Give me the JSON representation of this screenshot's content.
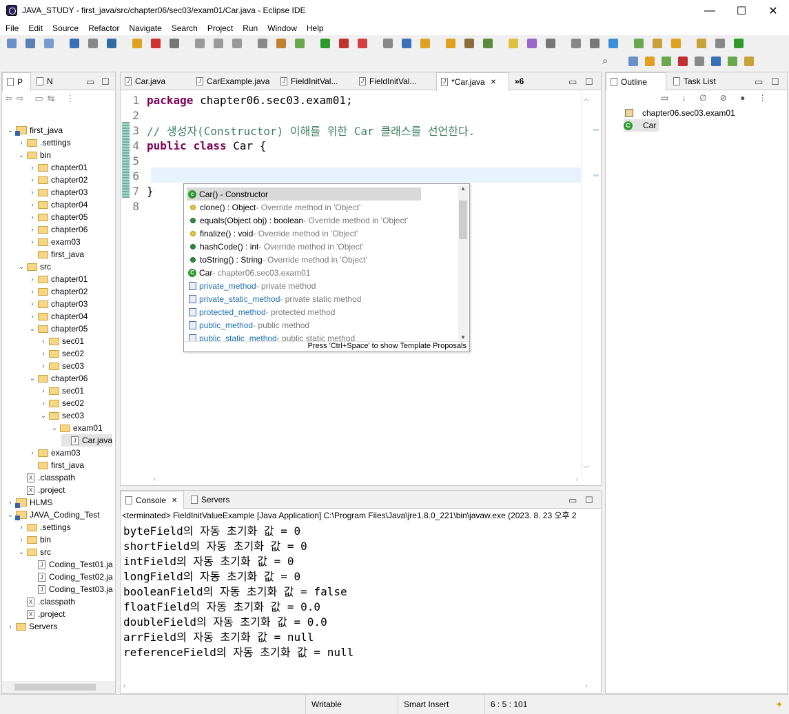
{
  "window": {
    "title": "JAVA_STUDY - first_java/src/chapter06/sec03/exam01/Car.java - Eclipse IDE",
    "minimize": "—",
    "maximize": "☐",
    "close": "✕"
  },
  "menu": [
    "File",
    "Edit",
    "Source",
    "Refactor",
    "Navigate",
    "Search",
    "Project",
    "Run",
    "Window",
    "Help"
  ],
  "explorer": {
    "tabs": [
      "P",
      "N"
    ],
    "tree": [
      {
        "label": "first_java",
        "arrow": "open",
        "type": "project",
        "level": 0
      },
      {
        "label": ".settings",
        "arrow": "closed",
        "type": "folder",
        "level": 1
      },
      {
        "label": "bin",
        "arrow": "open",
        "type": "folder",
        "level": 1
      },
      {
        "label": "chapter01",
        "arrow": "closed",
        "type": "folder",
        "level": 2
      },
      {
        "label": "chapter02",
        "arrow": "closed",
        "type": "folder",
        "level": 2
      },
      {
        "label": "chapter03",
        "arrow": "closed",
        "type": "folder",
        "level": 2
      },
      {
        "label": "chapter04",
        "arrow": "closed",
        "type": "folder",
        "level": 2
      },
      {
        "label": "chapter05",
        "arrow": "closed",
        "type": "folder",
        "level": 2
      },
      {
        "label": "chapter06",
        "arrow": "closed",
        "type": "folder",
        "level": 2
      },
      {
        "label": "exam03",
        "arrow": "closed",
        "type": "folder",
        "level": 2
      },
      {
        "label": "first_java",
        "arrow": "none",
        "type": "folder",
        "level": 2
      },
      {
        "label": "src",
        "arrow": "open",
        "type": "folder",
        "level": 1
      },
      {
        "label": "chapter01",
        "arrow": "closed",
        "type": "folder",
        "level": 2
      },
      {
        "label": "chapter02",
        "arrow": "closed",
        "type": "folder",
        "level": 2
      },
      {
        "label": "chapter03",
        "arrow": "closed",
        "type": "folder",
        "level": 2
      },
      {
        "label": "chapter04",
        "arrow": "closed",
        "type": "folder",
        "level": 2
      },
      {
        "label": "chapter05",
        "arrow": "open",
        "type": "folder",
        "level": 2
      },
      {
        "label": "sec01",
        "arrow": "closed",
        "type": "folder",
        "level": 3
      },
      {
        "label": "sec02",
        "arrow": "closed",
        "type": "folder",
        "level": 3
      },
      {
        "label": "sec03",
        "arrow": "closed",
        "type": "folder",
        "level": 3
      },
      {
        "label": "chapter06",
        "arrow": "open",
        "type": "folder",
        "level": 2
      },
      {
        "label": "sec01",
        "arrow": "closed",
        "type": "folder",
        "level": 3
      },
      {
        "label": "sec02",
        "arrow": "closed",
        "type": "folder",
        "level": 3
      },
      {
        "label": "sec03",
        "arrow": "open",
        "type": "folder",
        "level": 3
      },
      {
        "label": "exam01",
        "arrow": "open",
        "type": "folder",
        "level": 4
      },
      {
        "label": "Car.java",
        "arrow": "none",
        "type": "java",
        "level": 5,
        "selected": true
      },
      {
        "label": "exam03",
        "arrow": "closed",
        "type": "folder",
        "level": 2
      },
      {
        "label": "first_java",
        "arrow": "none",
        "type": "folder",
        "level": 2
      },
      {
        "label": ".classpath",
        "arrow": "none",
        "type": "xfile",
        "level": 1
      },
      {
        "label": ".project",
        "arrow": "none",
        "type": "xfile",
        "level": 1
      },
      {
        "label": "HLMS",
        "arrow": "closed",
        "type": "project",
        "level": 0
      },
      {
        "label": "JAVA_Coding_Test",
        "arrow": "open",
        "type": "project",
        "level": 0
      },
      {
        "label": ".settings",
        "arrow": "closed",
        "type": "folder",
        "level": 1
      },
      {
        "label": "bin",
        "arrow": "closed",
        "type": "folder",
        "level": 1
      },
      {
        "label": "src",
        "arrow": "open",
        "type": "folder",
        "level": 1
      },
      {
        "label": "Coding_Test01.ja",
        "arrow": "none",
        "type": "java",
        "level": 2
      },
      {
        "label": "Coding_Test02.ja",
        "arrow": "none",
        "type": "java",
        "level": 2
      },
      {
        "label": "Coding_Test03.ja",
        "arrow": "none",
        "type": "java",
        "level": 2
      },
      {
        "label": ".classpath",
        "arrow": "none",
        "type": "xfile",
        "level": 1
      },
      {
        "label": ".project",
        "arrow": "none",
        "type": "xfile",
        "level": 1
      },
      {
        "label": "Servers",
        "arrow": "closed",
        "type": "folder",
        "level": 0
      }
    ]
  },
  "editor": {
    "tabs": [
      {
        "label": "Car.java",
        "active": false
      },
      {
        "label": "CarExample.java",
        "active": false
      },
      {
        "label": "FieldInitVal...",
        "active": false
      },
      {
        "label": "FieldInitVal...",
        "active": false
      },
      {
        "label": "*Car.java",
        "active": true
      }
    ],
    "overflow": "»6",
    "lines": [
      {
        "n": "1",
        "parts": [
          {
            "t": "package",
            "c": "kw"
          },
          {
            "t": " chapter06.sec03.exam01;",
            "c": ""
          }
        ]
      },
      {
        "n": "2",
        "parts": []
      },
      {
        "n": "3",
        "parts": [
          {
            "t": "// 생성자(Constructor) 이해를 위한 Car 클래스를 선언한다.",
            "c": "cm"
          }
        ]
      },
      {
        "n": "4",
        "parts": [
          {
            "t": "public",
            "c": "kw"
          },
          {
            "t": " ",
            "c": ""
          },
          {
            "t": "class",
            "c": "kw"
          },
          {
            "t": " Car {",
            "c": ""
          }
        ]
      },
      {
        "n": "5",
        "parts": []
      },
      {
        "n": "6",
        "parts": []
      },
      {
        "n": "7",
        "parts": [
          {
            "t": "}",
            "c": ""
          }
        ]
      },
      {
        "n": "8",
        "parts": []
      }
    ]
  },
  "autocomplete": {
    "items": [
      {
        "name": "Car() - Constructor",
        "detail": "",
        "icon": "constructor",
        "color": "#2e9a2e",
        "selected": true
      },
      {
        "name": "clone() : Object",
        "detail": " - Override method in 'Object'",
        "icon": "dot",
        "color": "#e8c545"
      },
      {
        "name": "equals(Object obj) : boolean",
        "detail": " - Override method in 'Object'",
        "icon": "dot",
        "color": "#2e8b3e"
      },
      {
        "name": "finalize() : void",
        "detail": " - Override method in 'Object'",
        "icon": "dot",
        "color": "#e8c545"
      },
      {
        "name": "hashCode() : int",
        "detail": " - Override method in 'Object'",
        "icon": "dot",
        "color": "#2e8b3e"
      },
      {
        "name": "toString() : String",
        "detail": " - Override method in 'Object'",
        "icon": "dot",
        "color": "#2e8b3e"
      },
      {
        "name": "Car",
        "detail": " - chapter06.sec03.exam01",
        "icon": "class",
        "color": "#2e9a2e"
      },
      {
        "name": "private_method",
        "detail": " - private method",
        "icon": "template",
        "color": "#4a6fa5"
      },
      {
        "name": "private_static_method",
        "detail": " - private static method",
        "icon": "template",
        "color": "#4a6fa5"
      },
      {
        "name": "protected_method",
        "detail": " - protected method",
        "icon": "template",
        "color": "#4a6fa5"
      },
      {
        "name": "public_method",
        "detail": " - public method",
        "icon": "template",
        "color": "#4a6fa5"
      },
      {
        "name": "public_static_method",
        "detail": " - public static method",
        "icon": "template",
        "color": "#4a6fa5"
      }
    ],
    "hint": "Press 'Ctrl+Space' to show Template Proposals"
  },
  "outline": {
    "tabs": [
      "Outline",
      "Task List"
    ],
    "items": [
      {
        "label": "chapter06.sec03.exam01",
        "icon": "package"
      },
      {
        "label": "Car",
        "icon": "class"
      }
    ]
  },
  "console": {
    "tabs": [
      "Console",
      "Servers"
    ],
    "header": "<terminated> FieldInitValueExample [Java Application] C:\\Program Files\\Java\\jre1.8.0_221\\bin\\javaw.exe  (2023. 8. 23 오후 2",
    "lines": [
      "byteField의 자동 초기화 값 = 0",
      "shortField의 자동 초기화 값 = 0",
      "intField의 자동 초기화 값 = 0",
      "longField의 자동 초기화 값 = 0",
      "booleanField의 자동 초기화 값 = false",
      "floatField의 자동 초기화 값 = 0.0",
      "doubleField의 자동 초기화 값 = 0.0",
      "arrField의 자동 초기화 값 = null",
      "referenceField의 자동 초기화 값 = null"
    ]
  },
  "status": {
    "writable": "Writable",
    "insert": "Smart Insert",
    "position": "6 : 5 : 101"
  },
  "colors": {
    "accent": "#dfe8f6",
    "keyword": "#7f0055",
    "comment": "#3f7f5f"
  }
}
